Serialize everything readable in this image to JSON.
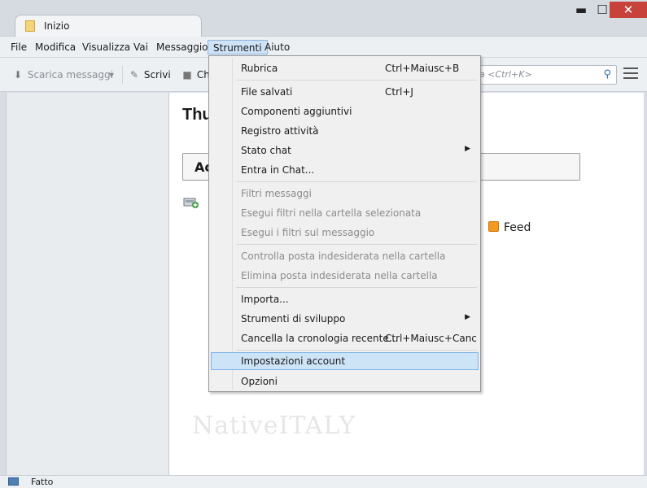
{
  "window": {
    "tab_label": "Inizio",
    "min_label": "▬",
    "max_label": "☐",
    "close_label": "✕"
  },
  "menubar": {
    "items": [
      {
        "label": "File"
      },
      {
        "label": "Modifica"
      },
      {
        "label": "Visualizza"
      },
      {
        "label": "Vai"
      },
      {
        "label": "Messaggio"
      },
      {
        "label": "Strumenti"
      },
      {
        "label": "Aiuto"
      }
    ]
  },
  "toolbar": {
    "download_label": "Scarica messaggi",
    "write_label": "Scrivi",
    "chat_label": "Ch",
    "search_placeholder": "a <Ctrl+K>"
  },
  "content": {
    "title": "Thu",
    "account_box_label": "Ac",
    "feed_label": "Feed",
    "watermark": "NativeITALY"
  },
  "status": {
    "text": "Fatto"
  },
  "tools_menu": {
    "items": [
      {
        "label": "Rubrica",
        "shortcut": "Ctrl+Maiusc+B"
      },
      {
        "label": "File salvati",
        "shortcut": "Ctrl+J"
      },
      {
        "label": "Componenti aggiuntivi",
        "shortcut": ""
      },
      {
        "label": "Registro attività",
        "shortcut": ""
      },
      {
        "label": "Stato chat",
        "shortcut": ""
      },
      {
        "label": "Entra in Chat...",
        "shortcut": ""
      },
      {
        "label": "Filtri messaggi",
        "shortcut": ""
      },
      {
        "label": "Esegui filtri nella cartella selezionata",
        "shortcut": ""
      },
      {
        "label": "Esegui i filtri sul messaggio",
        "shortcut": ""
      },
      {
        "label": "Controlla posta indesiderata nella cartella",
        "shortcut": ""
      },
      {
        "label": "Elimina posta indesiderata nella cartella",
        "shortcut": ""
      },
      {
        "label": "Importa...",
        "shortcut": ""
      },
      {
        "label": "Strumenti di sviluppo",
        "shortcut": ""
      },
      {
        "label": "Cancella la cronologia recente...",
        "shortcut": "Ctrl+Maiusc+Canc"
      },
      {
        "label": "Impostazioni account",
        "shortcut": ""
      },
      {
        "label": "Opzioni",
        "shortcut": ""
      }
    ]
  },
  "colors": {
    "highlight": "#cde3f6",
    "close_button": "#c7423a"
  }
}
